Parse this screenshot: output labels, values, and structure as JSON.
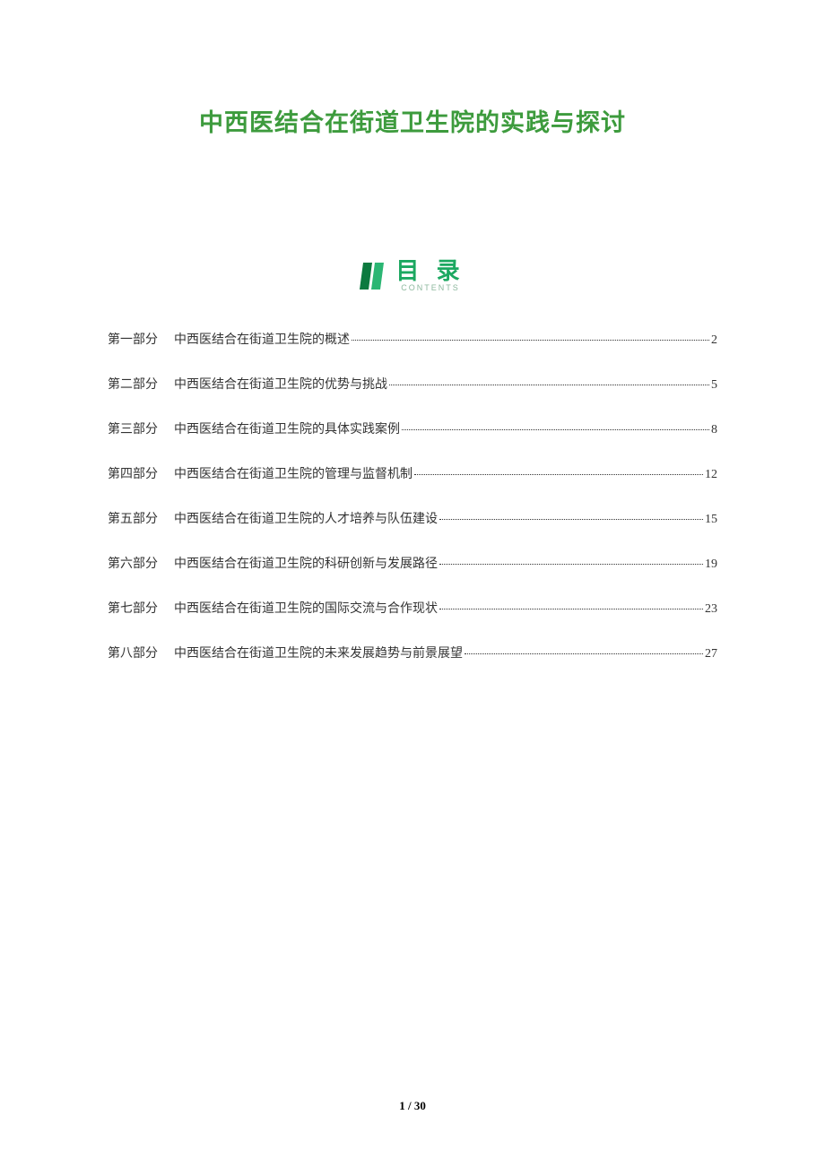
{
  "title": "中西医结合在街道卫生院的实践与探讨",
  "toc": {
    "heading": "目 录",
    "subheading": "CONTENTS",
    "items": [
      {
        "part": "第一部分",
        "text": "中西医结合在街道卫生院的概述",
        "page": "2"
      },
      {
        "part": "第二部分",
        "text": "中西医结合在街道卫生院的优势与挑战",
        "page": "5"
      },
      {
        "part": "第三部分",
        "text": "中西医结合在街道卫生院的具体实践案例",
        "page": "8"
      },
      {
        "part": "第四部分",
        "text": "中西医结合在街道卫生院的管理与监督机制",
        "page": "12"
      },
      {
        "part": "第五部分",
        "text": "中西医结合在街道卫生院的人才培养与队伍建设",
        "page": "15"
      },
      {
        "part": "第六部分",
        "text": "中西医结合在街道卫生院的科研创新与发展路径",
        "page": "19"
      },
      {
        "part": "第七部分",
        "text": "中西医结合在街道卫生院的国际交流与合作现状",
        "page": "23"
      },
      {
        "part": "第八部分",
        "text": "中西医结合在街道卫生院的未来发展趋势与前景展望",
        "page": "27"
      }
    ]
  },
  "pagination": {
    "current": "1",
    "separator": " / ",
    "total": "30"
  },
  "colors": {
    "title_green": "#3d9b3d",
    "toc_green": "#1ca861",
    "toc_sub": "#8db89e"
  }
}
